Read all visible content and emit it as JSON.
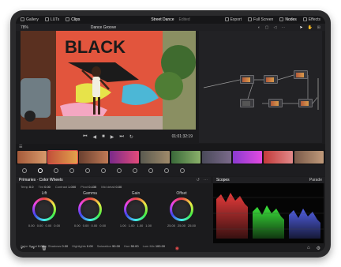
{
  "topbar": {
    "left": [
      {
        "icon": "grid-icon",
        "label": "Gallery"
      },
      {
        "icon": "lut-icon",
        "label": "LUTs"
      },
      {
        "icon": "clips-icon",
        "label": "Clips"
      }
    ],
    "project": "Street Dance",
    "status": "Edited",
    "right": [
      {
        "icon": "export-icon",
        "label": "Export"
      },
      {
        "icon": "fullscreen-icon",
        "label": "Full Screen"
      },
      {
        "icon": "nodes-icon",
        "label": "Nodes"
      },
      {
        "icon": "effects-icon",
        "label": "Effects"
      }
    ]
  },
  "viewer": {
    "zoom": "78%",
    "clip_title": "Dance Groove",
    "timecode": "01:01:32:19",
    "mural_text": "BLACK"
  },
  "color_wheels": {
    "panel_title": "Primaries · Color Wheels",
    "top_params": [
      {
        "label": "Temp",
        "value": "0.0"
      },
      {
        "label": "Tint",
        "value": "0.00"
      },
      {
        "label": "Contrast",
        "value": "1.000"
      },
      {
        "label": "Pivot",
        "value": "0.435"
      },
      {
        "label": "Mid detail",
        "value": "0.00"
      }
    ],
    "wheels": [
      {
        "name": "Lift",
        "vals": [
          "0.00",
          "0.00",
          "0.00",
          "0.00"
        ]
      },
      {
        "name": "Gamma",
        "vals": [
          "0.00",
          "0.00",
          "0.00",
          "0.00"
        ]
      },
      {
        "name": "Gain",
        "vals": [
          "1.00",
          "1.00",
          "1.00",
          "1.00"
        ]
      },
      {
        "name": "Offset",
        "vals": [
          "25.00",
          "25.00",
          "25.00"
        ]
      }
    ],
    "bottom_params": [
      {
        "label": "Color Boost",
        "value": "0.00"
      },
      {
        "label": "Shadows",
        "value": "0.00"
      },
      {
        "label": "Highlights",
        "value": "0.00"
      },
      {
        "label": "Saturation",
        "value": "50.00"
      },
      {
        "label": "Hue",
        "value": "50.00"
      },
      {
        "label": "Lum Mix",
        "value": "100.00"
      }
    ]
  },
  "scopes": {
    "title": "Scopes",
    "mode": "Parade"
  },
  "colors": {
    "accent_red": "#e24b4b",
    "background": "#1b1b1d"
  }
}
